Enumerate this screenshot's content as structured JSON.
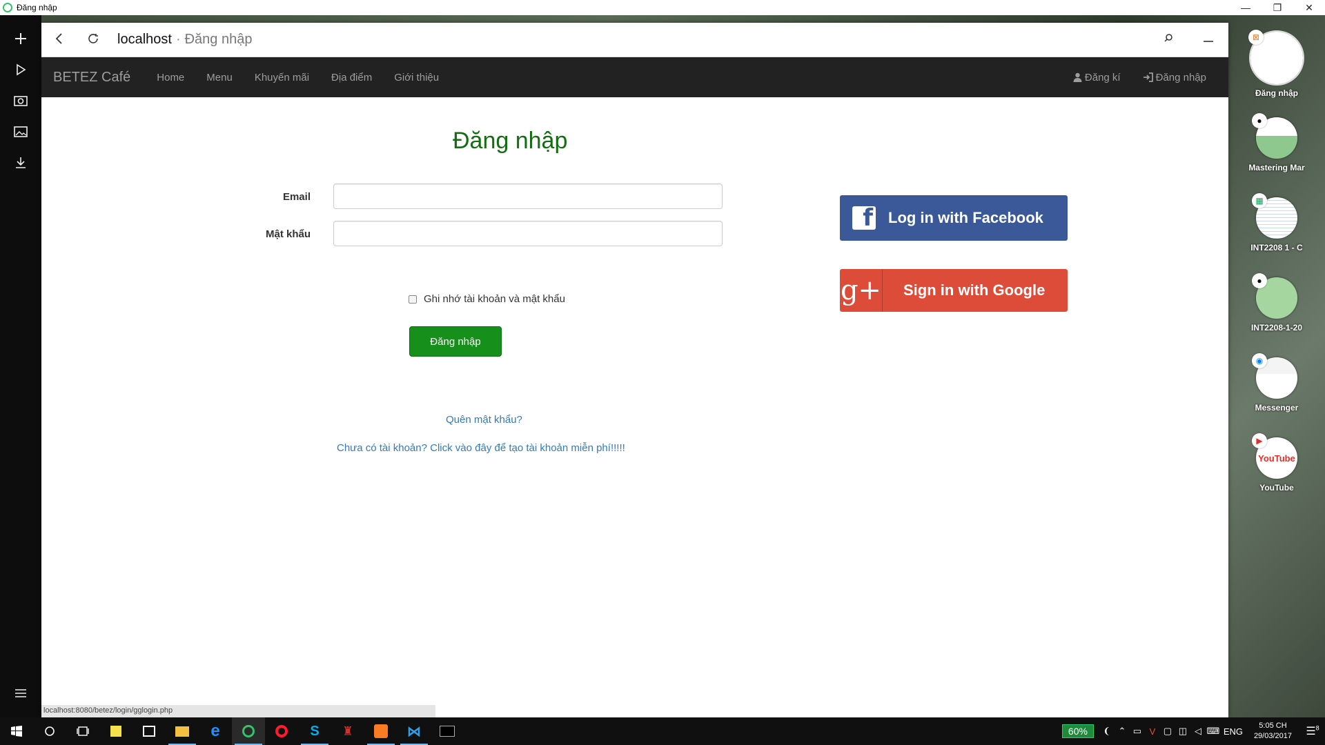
{
  "window": {
    "title": "Đăng nhập",
    "controls": [
      "—",
      "❐",
      "✕"
    ]
  },
  "left_rail": {
    "icons": [
      "add-icon",
      "play-icon",
      "camera-icon",
      "image-icon",
      "download-icon"
    ],
    "menu_icon": "hamburger-icon"
  },
  "address_bar": {
    "host": "localhost",
    "separator": "·",
    "page_title": "Đăng nhập"
  },
  "navbar": {
    "brand": "BETEZ Café",
    "links": [
      "Home",
      "Menu",
      "Khuyến mãi",
      "Địa điểm",
      "Giới thiệu"
    ],
    "register": "Đăng kí",
    "login": "Đăng nhập"
  },
  "login_form": {
    "heading": "Đăng nhập",
    "email_label": "Email",
    "email_value": "",
    "password_label": "Mật khẩu",
    "password_value": "",
    "remember_label": "Ghi nhớ tài khoản và mật khẩu",
    "remember_checked": false,
    "submit_label": "Đăng nhập",
    "forgot_link": "Quên mật khẩu?",
    "signup_link": "Chưa có tài khoản? Click vào đây để tạo tài khoản miễn phí!!!!!"
  },
  "social": {
    "facebook_label": "Log in with Facebook",
    "facebook_color": "#3b5998",
    "google_label": "Sign in with Google",
    "google_color": "#dd4b39",
    "google_icon_text": "g+"
  },
  "status_url": "localhost:8080/betez/login/gglogin.php",
  "sidebar_tiles": [
    {
      "name": "Đăng nhập",
      "badge": "xampp-icon"
    },
    {
      "name": "Mastering Mar",
      "badge": "github-icon"
    },
    {
      "name": "INT2208 1 - C",
      "badge": "sheets-icon"
    },
    {
      "name": "INT2208-1-20",
      "badge": "github-icon"
    },
    {
      "name": "Messenger",
      "badge": "messenger-icon"
    },
    {
      "name": "YouTube",
      "badge": "youtube-icon",
      "thumb_text": "YouTube"
    }
  ],
  "taskbar": {
    "battery": "60%",
    "language": "ENG",
    "time": "5:05 CH",
    "date": "29/03/2017",
    "notification_count": "8"
  }
}
